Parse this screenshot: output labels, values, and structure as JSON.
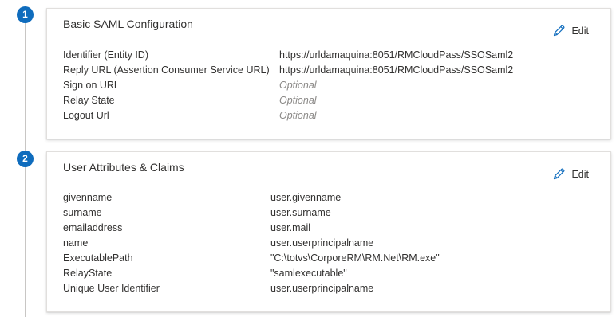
{
  "steps": [
    "1",
    "2"
  ],
  "saml": {
    "title": "Basic SAML Configuration",
    "edit_label": "Edit",
    "rows": [
      {
        "label": "Identifier (Entity ID)",
        "value": "https://urldamaquina:8051/RMCloudPass/SSOSaml2",
        "optional": false
      },
      {
        "label": "Reply URL (Assertion Consumer Service URL)",
        "value": "https://urldamaquina:8051/RMCloudPass/SSOSaml2",
        "optional": false
      },
      {
        "label": "Sign on URL",
        "value": "Optional",
        "optional": true
      },
      {
        "label": "Relay State",
        "value": "Optional",
        "optional": true
      },
      {
        "label": "Logout Url",
        "value": "Optional",
        "optional": true
      }
    ]
  },
  "claims": {
    "title": "User Attributes & Claims",
    "edit_label": "Edit",
    "rows": [
      {
        "label": "givenname",
        "value": "user.givenname"
      },
      {
        "label": "surname",
        "value": "user.surname"
      },
      {
        "label": "emailaddress",
        "value": "user.mail"
      },
      {
        "label": "name",
        "value": "user.userprincipalname"
      },
      {
        "label": "ExecutablePath",
        "value": "\"C:\\totvs\\CorporeRM\\RM.Net\\RM.exe\""
      },
      {
        "label": "RelayState",
        "value": "\"samlexecutable\""
      },
      {
        "label": "Unique User Identifier",
        "value": "user.userprincipalname"
      }
    ]
  },
  "colors": {
    "accent": "#0f6cbd",
    "text": "#323130",
    "placeholder": "#8a8886"
  },
  "icons": {
    "edit": "pencil-icon"
  }
}
